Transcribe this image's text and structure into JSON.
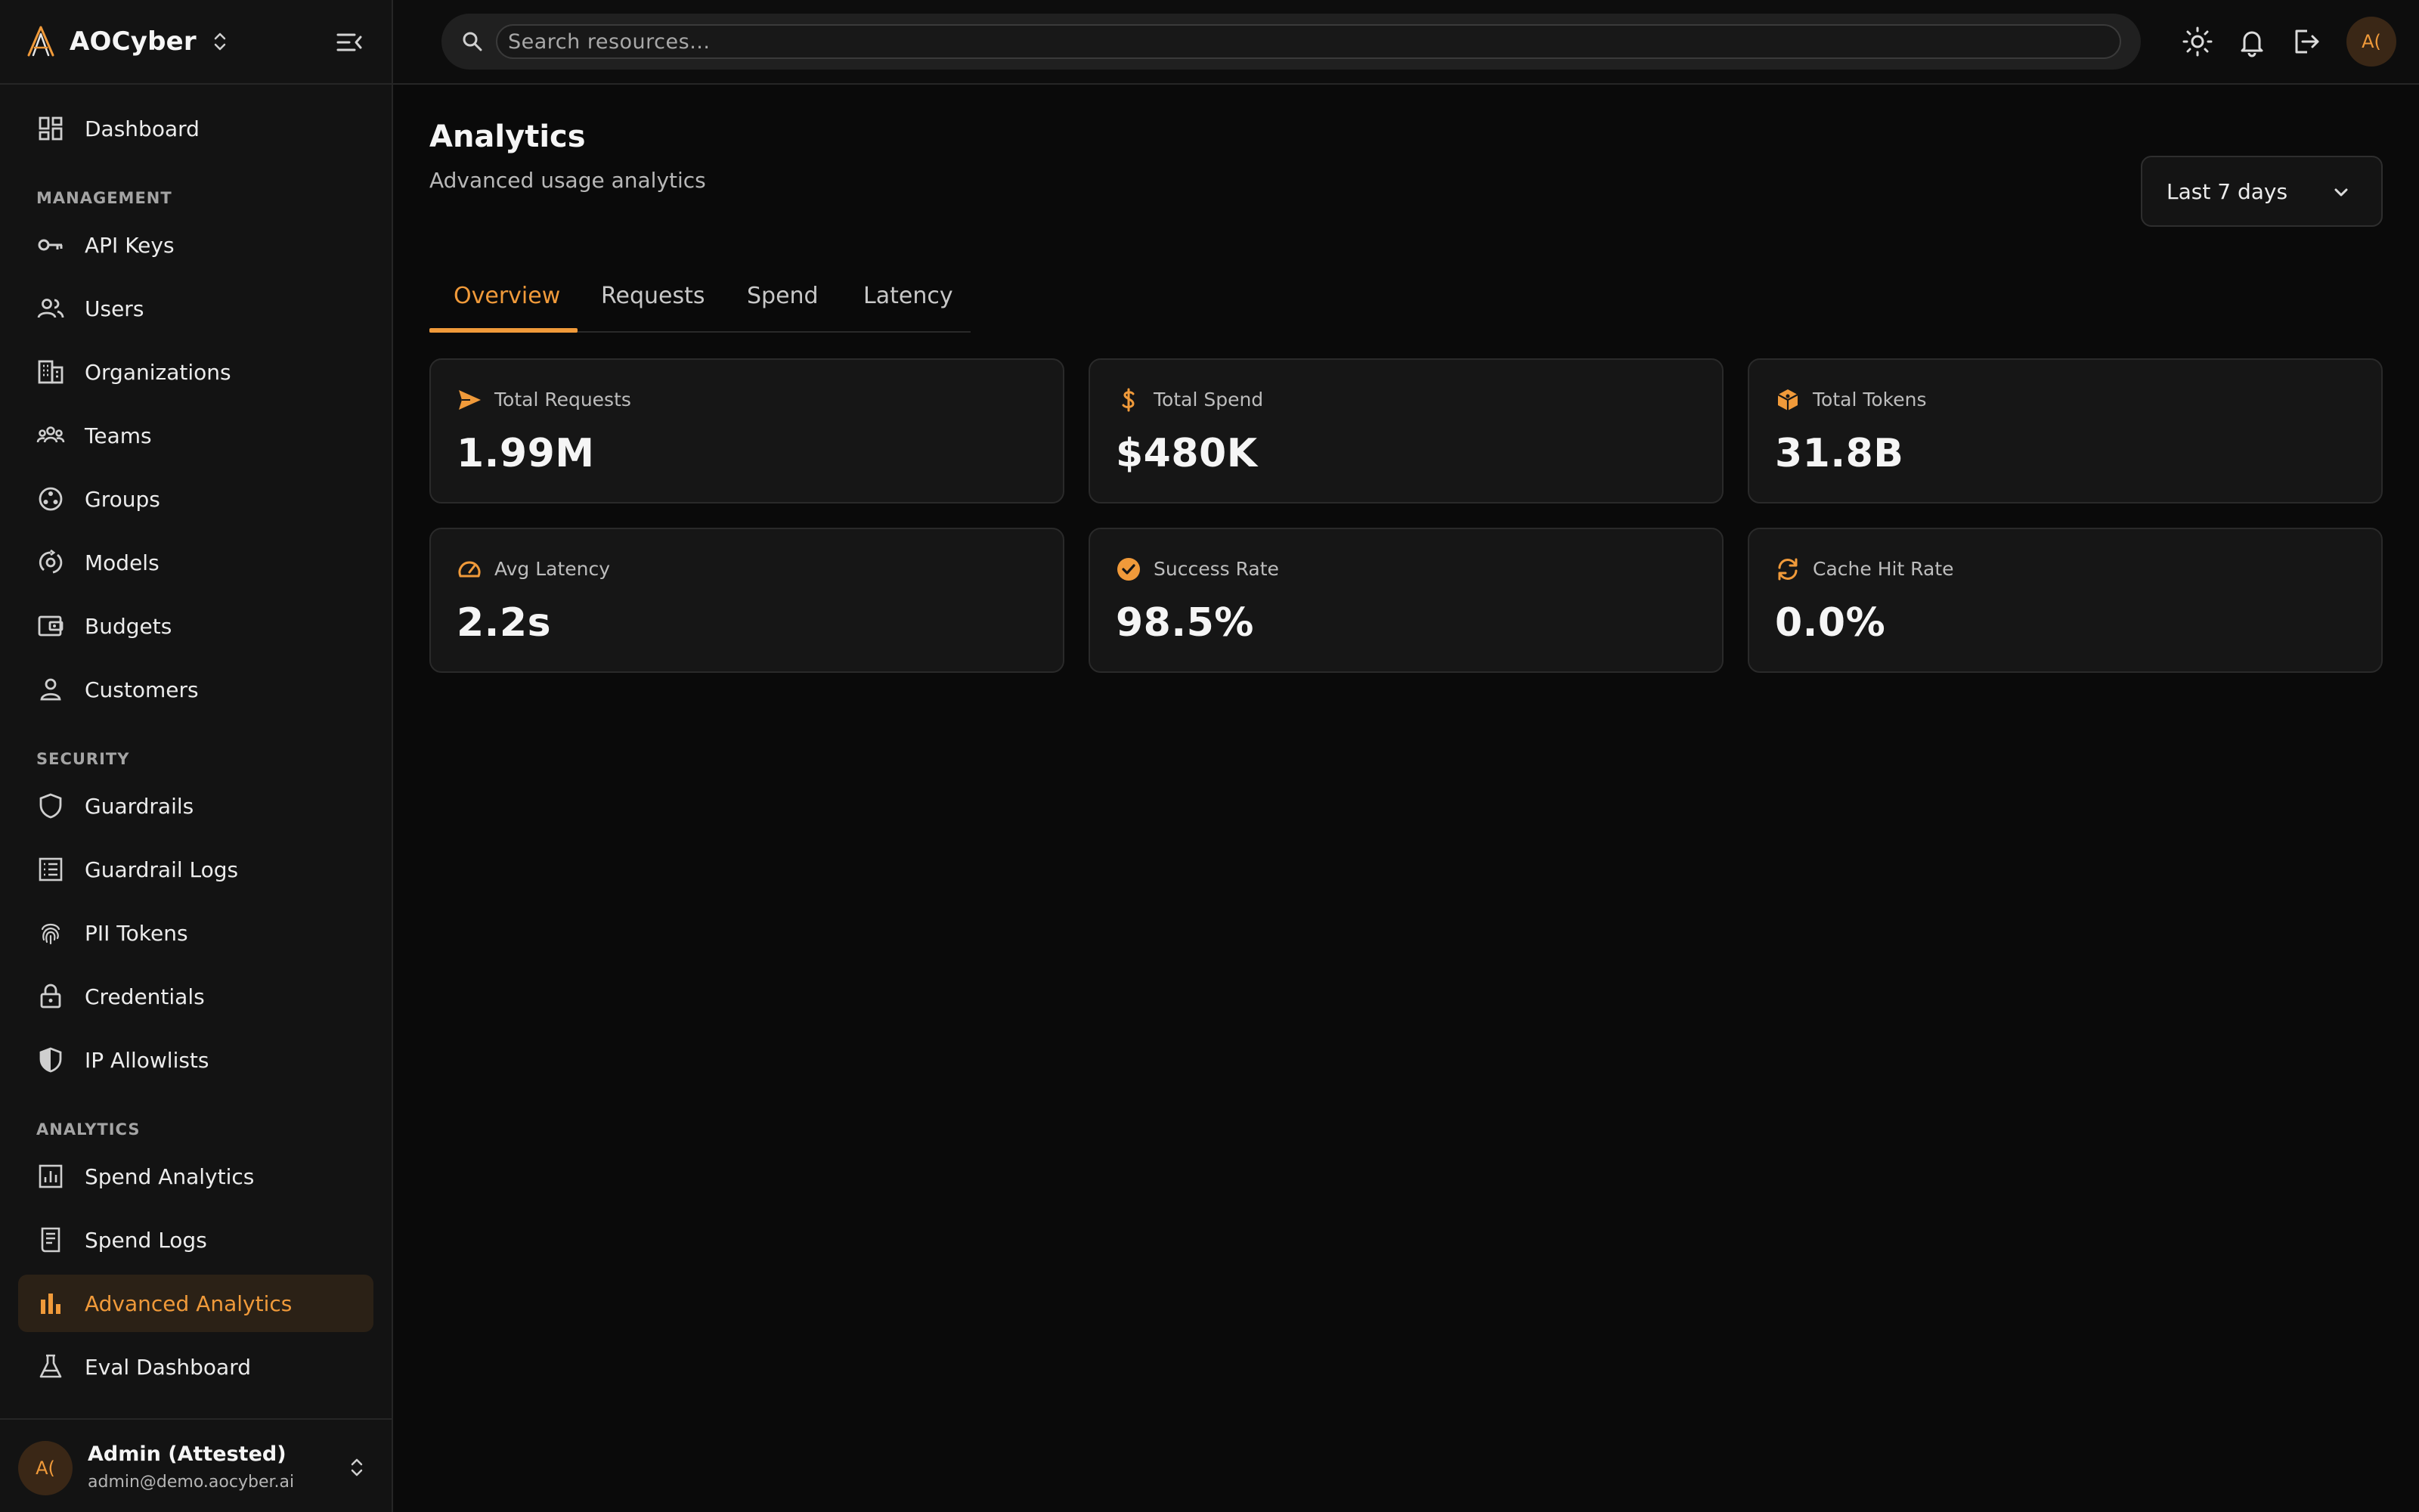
{
  "brand": {
    "name": "AOCyber"
  },
  "search": {
    "placeholder": "Search resources..."
  },
  "header": {
    "avatar_initials": "A("
  },
  "sidebar": {
    "dashboard": {
      "label": "Dashboard"
    },
    "sections": {
      "management": "MANAGEMENT",
      "security": "SECURITY",
      "analytics": "ANALYTICS"
    },
    "management_items": [
      {
        "label": "API Keys",
        "icon": "key-icon"
      },
      {
        "label": "Users",
        "icon": "users-icon"
      },
      {
        "label": "Organizations",
        "icon": "building-icon"
      },
      {
        "label": "Teams",
        "icon": "teams-icon"
      },
      {
        "label": "Groups",
        "icon": "groups-icon"
      },
      {
        "label": "Models",
        "icon": "models-icon"
      },
      {
        "label": "Budgets",
        "icon": "wallet-icon"
      },
      {
        "label": "Customers",
        "icon": "person-icon"
      }
    ],
    "security_items": [
      {
        "label": "Guardrails",
        "icon": "shield-icon"
      },
      {
        "label": "Guardrail Logs",
        "icon": "log-list-icon"
      },
      {
        "label": "PII Tokens",
        "icon": "fingerprint-icon"
      },
      {
        "label": "Credentials",
        "icon": "lock-icon"
      },
      {
        "label": "IP Allowlists",
        "icon": "shield-half-icon"
      }
    ],
    "analytics_items": [
      {
        "label": "Spend Analytics",
        "icon": "chart-box-icon"
      },
      {
        "label": "Spend Logs",
        "icon": "receipt-icon"
      },
      {
        "label": "Advanced Analytics",
        "icon": "bar-chart-icon",
        "active": true
      },
      {
        "label": "Eval Dashboard",
        "icon": "flask-icon"
      }
    ]
  },
  "user": {
    "initials": "A(",
    "name": "Admin (Attested)",
    "email": "admin@demo.aocyber.ai"
  },
  "page": {
    "title": "Analytics",
    "subtitle": "Advanced usage analytics",
    "range": "Last 7 days"
  },
  "tabs": [
    {
      "label": "Overview",
      "active": true
    },
    {
      "label": "Requests"
    },
    {
      "label": "Spend"
    },
    {
      "label": "Latency"
    }
  ],
  "stats": [
    {
      "label": "Total Requests",
      "value": "1.99M",
      "icon": "send-icon"
    },
    {
      "label": "Total Spend",
      "value": "$480K",
      "icon": "dollar-icon"
    },
    {
      "label": "Total Tokens",
      "value": "31.8B",
      "icon": "cube-icon"
    },
    {
      "label": "Avg Latency",
      "value": "2.2s",
      "icon": "speedometer-icon"
    },
    {
      "label": "Success Rate",
      "value": "98.5%",
      "icon": "check-circle-icon"
    },
    {
      "label": "Cache Hit Rate",
      "value": "0.0%",
      "icon": "refresh-icon"
    }
  ],
  "colors": {
    "accent": "#f09a3a",
    "background": "#0a0a0a",
    "sidebar": "#131313",
    "card": "#161616"
  }
}
